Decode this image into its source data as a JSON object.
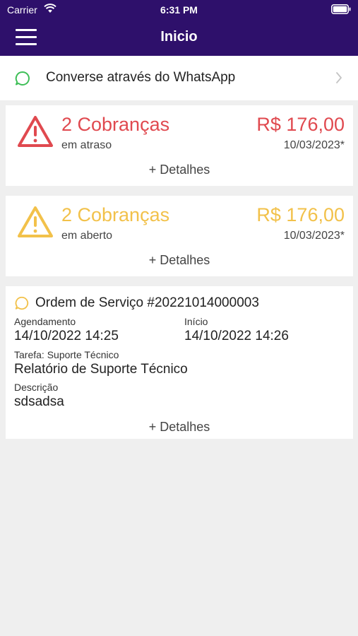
{
  "status_bar": {
    "carrier": "Carrier",
    "time": "6:31 PM"
  },
  "nav": {
    "title": "Inicio",
    "menu_icon": "hamburger-menu-icon"
  },
  "whatsapp": {
    "label": "Converse através do WhatsApp",
    "icon": "chat-bubble-icon",
    "icon_color": "#3fbf58"
  },
  "bills": [
    {
      "title": "2 Cobranças",
      "status": "em atraso",
      "amount": "R$ 176,00",
      "date": "10/03/2023*",
      "details": "+ Detalhes",
      "color": "#e0494f",
      "icon": "warning-triangle-icon"
    },
    {
      "title": "2 Cobranças",
      "status": "em aberto",
      "amount": "R$ 176,00",
      "date": "10/03/2023*",
      "details": "+ Detalhes",
      "color": "#f2c14a",
      "icon": "warning-triangle-icon"
    }
  ],
  "service_order": {
    "title": "Ordem de Serviço #20221014000003",
    "icon": "chat-bubble-icon",
    "icon_color": "#f2c14a",
    "scheduling_label": "Agendamento",
    "scheduling_value": "14/10/2022 14:25",
    "start_label": "Início",
    "start_value": "14/10/2022 14:26",
    "task_label": "Tarefa: Suporte Técnico",
    "task_value": "Relatório de Suporte Técnico",
    "description_label": "Descrição",
    "description_value": "sdsadsa",
    "details": "+ Detalhes"
  },
  "colors": {
    "header": "#2e106b",
    "background": "#efefef"
  }
}
